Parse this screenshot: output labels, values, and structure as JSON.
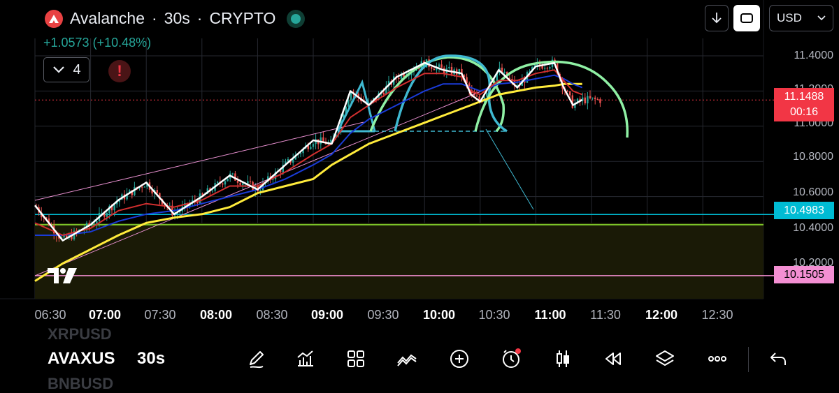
{
  "header": {
    "symbol_name": "Avalanche",
    "interval": "30s",
    "exchange": "CRYPTO",
    "separator": "·",
    "change": "+1.0573 (+10.48%)",
    "indicators_count": "4",
    "brand_color": "#e84142",
    "up_color": "#26a69a"
  },
  "toolbar": {
    "currency": "USD",
    "download_icon": "arrow-down-icon",
    "fullscreen_icon": "fullscreen-icon"
  },
  "price_axis": {
    "labels": [
      "11.4000",
      "11.2000",
      "11.0000",
      "10.8000",
      "10.6000",
      "10.4000",
      "10.2000"
    ],
    "current_price": "11.1488",
    "countdown": "00:16",
    "level_blue": "10.4983",
    "level_pink": "10.1505",
    "colors": {
      "current": "#f23645",
      "blue": "#00bcd4",
      "pink": "#f48fd3"
    }
  },
  "time_axis": {
    "labels": [
      {
        "text": "06:30",
        "bold": false
      },
      {
        "text": "07:00",
        "bold": true
      },
      {
        "text": "07:30",
        "bold": false
      },
      {
        "text": "08:00",
        "bold": true
      },
      {
        "text": "08:30",
        "bold": false
      },
      {
        "text": "09:00",
        "bold": true
      },
      {
        "text": "09:30",
        "bold": false
      },
      {
        "text": "10:00",
        "bold": true
      },
      {
        "text": "10:30",
        "bold": false
      },
      {
        "text": "11:00",
        "bold": true
      },
      {
        "text": "11:30",
        "bold": false
      },
      {
        "text": "12:00",
        "bold": true
      },
      {
        "text": "12:30",
        "bold": false
      }
    ]
  },
  "chart_data": {
    "type": "line",
    "xlabel": "",
    "ylabel": "",
    "ylim": [
      10.08,
      11.52
    ],
    "x": [
      "06:30",
      "06:45",
      "07:00",
      "07:15",
      "07:30",
      "07:45",
      "08:00",
      "08:15",
      "08:30",
      "08:45",
      "09:00",
      "09:10",
      "09:20",
      "09:30",
      "09:45",
      "10:00",
      "10:10",
      "10:20",
      "10:25",
      "10:30",
      "10:40",
      "10:50",
      "11:00",
      "11:10",
      "11:15",
      "11:20",
      "11:25"
    ],
    "series": [
      {
        "color": "#ffffff",
        "values": [
          10.55,
          10.35,
          10.44,
          10.58,
          10.68,
          10.5,
          10.6,
          10.72,
          10.64,
          10.78,
          10.92,
          10.9,
          11.2,
          11.12,
          11.28,
          11.36,
          11.32,
          11.3,
          11.18,
          11.14,
          11.32,
          11.22,
          11.34,
          11.36,
          11.22,
          11.12,
          11.15
        ]
      },
      {
        "color": "#d32f2f",
        "values": [
          10.45,
          10.38,
          10.42,
          10.52,
          10.56,
          10.54,
          10.58,
          10.66,
          10.66,
          10.74,
          10.84,
          10.9,
          11.05,
          11.12,
          11.22,
          11.3,
          11.3,
          11.28,
          11.2,
          11.18,
          11.26,
          11.26,
          11.3,
          11.32,
          11.26,
          11.2,
          11.18
        ]
      },
      {
        "color": "#1a3bd8",
        "values": [
          10.38,
          10.38,
          10.4,
          10.46,
          10.5,
          10.52,
          10.56,
          10.6,
          10.64,
          10.7,
          10.78,
          10.84,
          10.96,
          11.04,
          11.12,
          11.2,
          11.24,
          11.24,
          11.22,
          11.2,
          11.24,
          11.25,
          11.27,
          11.29,
          11.27,
          11.24,
          11.22
        ]
      },
      {
        "color": "#ffeb3b",
        "values": [
          10.12,
          10.22,
          10.3,
          10.38,
          10.45,
          10.48,
          10.5,
          10.54,
          10.62,
          10.66,
          10.7,
          10.78,
          10.84,
          10.9,
          10.96,
          11.02,
          11.06,
          11.1,
          11.12,
          11.14,
          11.18,
          11.2,
          11.22,
          11.23,
          11.24,
          11.24,
          11.24
        ]
      }
    ]
  },
  "bottom_bar": {
    "symbol_prev": "XRPUSD",
    "symbol": "AVAXUS",
    "symbol_next": "BNBUSD",
    "timeframe": "30s",
    "tools": [
      {
        "name": "draw-tool-icon"
      },
      {
        "name": "indicators-icon"
      },
      {
        "name": "layouts-grid-icon"
      },
      {
        "name": "patterns-icon"
      },
      {
        "name": "add-icon"
      },
      {
        "name": "alert-clock-icon"
      },
      {
        "name": "candle-type-icon"
      },
      {
        "name": "replay-icon"
      },
      {
        "name": "layers-icon"
      },
      {
        "name": "more-icon"
      },
      {
        "name": "undo-icon"
      }
    ]
  }
}
